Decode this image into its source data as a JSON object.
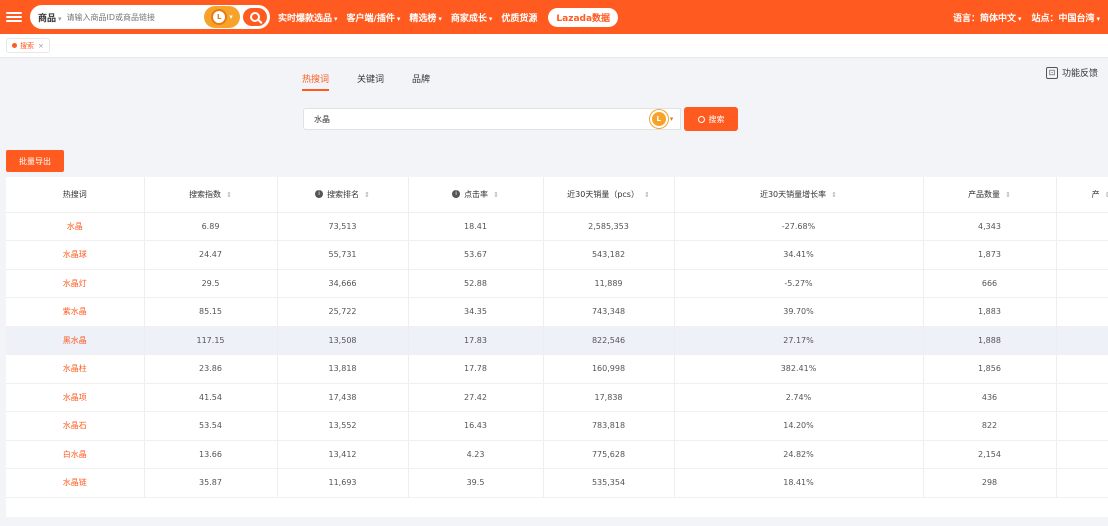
{
  "topbar": {
    "search_scope": "商品",
    "search_placeholder": "请输入商品ID或商品链接",
    "logo_text": "L",
    "nav": [
      "实时爆款选品",
      "客户端/插件",
      "精选榜",
      "商家成长",
      "优质货源",
      "Lazada数据"
    ],
    "language": "语言：简体中文",
    "region": "站点：中国台湾"
  },
  "tagbar": {
    "tab_label": "搜索"
  },
  "content": {
    "feedback_label": "功能反馈",
    "tabs": [
      "热搜词",
      "关键词",
      "品牌"
    ],
    "active_tab": 0,
    "keyword_value": "水晶",
    "search_button": "搜索",
    "export_button": "批量导出"
  },
  "table": {
    "columns": [
      {
        "label": "热搜词",
        "sortable": false,
        "info": false
      },
      {
        "label": "搜索指数",
        "sortable": true,
        "info": false
      },
      {
        "label": "搜索排名",
        "sortable": true,
        "info": true
      },
      {
        "label": "点击率",
        "sortable": true,
        "info": true
      },
      {
        "label": "近30天销量（pcs）",
        "sortable": true,
        "info": false
      },
      {
        "label": "近30天销量增长率",
        "sortable": true,
        "info": false
      },
      {
        "label": "产品数量",
        "sortable": true,
        "info": false
      },
      {
        "label": "产",
        "sortable": true,
        "info": false
      }
    ],
    "rows": [
      [
        "水晶",
        "6.89",
        "73,513",
        "18.41",
        "2,585,353",
        "-27.68%",
        "4,343"
      ],
      [
        "水晶球",
        "24.47",
        "55,731",
        "53.67",
        "543,182",
        "34.41%",
        "1,873"
      ],
      [
        "水晶灯",
        "29.5",
        "34,666",
        "52.88",
        "11,889",
        "-5.27%",
        "666"
      ],
      [
        "紫水晶",
        "85.15",
        "25,722",
        "34.35",
        "743,348",
        "39.70%",
        "1,883"
      ],
      [
        "黑水晶",
        "117.15",
        "13,508",
        "17.83",
        "822,546",
        "27.17%",
        "1,888"
      ],
      [
        "水晶柱",
        "23.86",
        "13,818",
        "17.78",
        "160,998",
        "382.41%",
        "1,856"
      ],
      [
        "水晶项",
        "41.54",
        "17,438",
        "27.42",
        "17,838",
        "2.74%",
        "436"
      ],
      [
        "水晶石",
        "53.54",
        "13,552",
        "16.43",
        "783,818",
        "14.20%",
        "822"
      ],
      [
        "白水晶",
        "13.66",
        "13,412",
        "4.23",
        "775,628",
        "24.82%",
        "2,154"
      ],
      [
        "水晶链",
        "35.87",
        "11,693",
        "39.5",
        "535,354",
        "18.41%",
        "298"
      ]
    ],
    "highlighted_row": 4
  },
  "colors": {
    "accent": "#ff5a1f",
    "logo": "#f6a22b"
  }
}
